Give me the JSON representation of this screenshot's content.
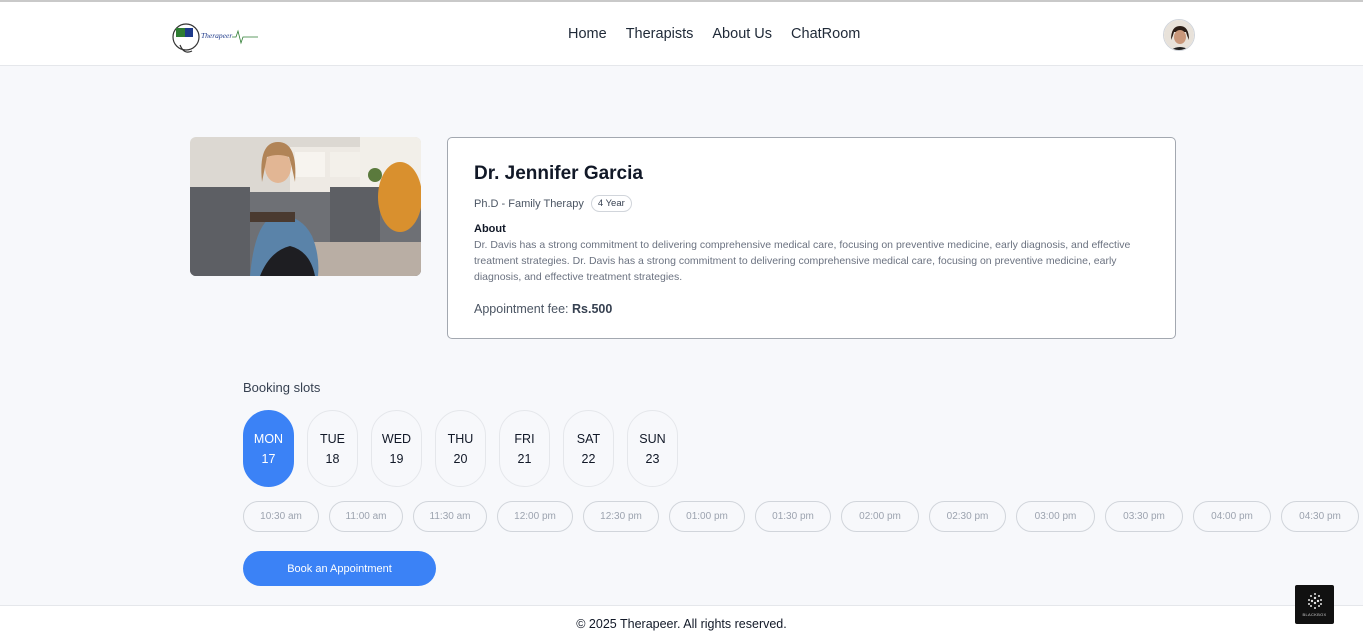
{
  "nav": {
    "logo_text": "Therapeer",
    "links": [
      "Home",
      "Therapists",
      "About Us",
      "ChatRoom"
    ]
  },
  "doctor": {
    "name": "Dr. Jennifer Garcia",
    "degree": "Ph.D - Family Therapy",
    "experience": "4 Year",
    "about_label": "About",
    "about_text": "Dr. Davis has a strong commitment to delivering comprehensive medical care, focusing on preventive medicine, early diagnosis, and effective treatment strategies. Dr. Davis has a strong commitment to delivering comprehensive medical care, focusing on preventive medicine, early diagnosis, and effective treatment strategies.",
    "fee_label": "Appointment fee:",
    "fee_value": "Rs.500"
  },
  "booking": {
    "title": "Booking slots",
    "days": [
      {
        "day": "MON",
        "date": "17"
      },
      {
        "day": "TUE",
        "date": "18"
      },
      {
        "day": "WED",
        "date": "19"
      },
      {
        "day": "THU",
        "date": "20"
      },
      {
        "day": "FRI",
        "date": "21"
      },
      {
        "day": "SAT",
        "date": "22"
      },
      {
        "day": "SUN",
        "date": "23"
      }
    ],
    "selected_day": "MON",
    "times": [
      "10:30 am",
      "11:00 am",
      "11:30 am",
      "12:00 pm",
      "12:30 pm",
      "01:00 pm",
      "01:30 pm",
      "02:00 pm",
      "02:30 pm",
      "03:00 pm",
      "03:30 pm",
      "04:00 pm",
      "04:30 pm"
    ],
    "button_label": "Book an Appointment"
  },
  "footer": {
    "text": "© 2025 Therapeer. All rights reserved."
  },
  "badge": {
    "text": "BLACKBOX"
  },
  "colors": {
    "accent": "#3b82f6",
    "background": "#f7f8fb"
  }
}
